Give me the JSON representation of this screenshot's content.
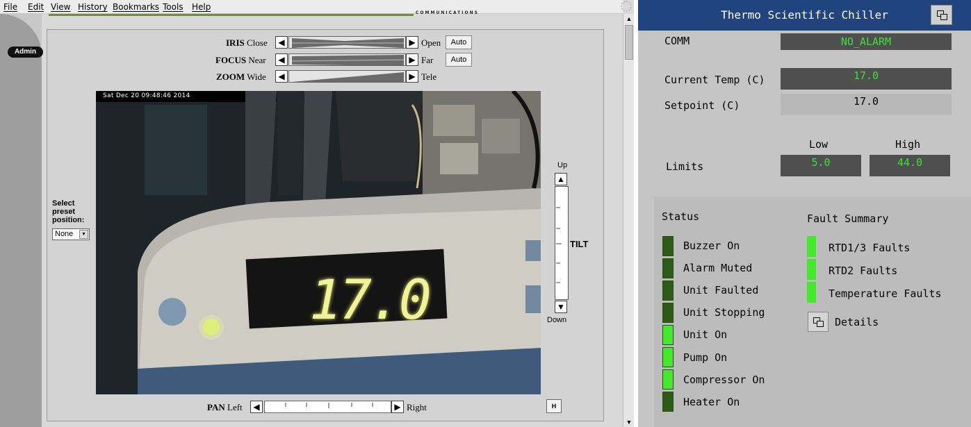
{
  "browser": {
    "menu": [
      "File",
      "Edit",
      "View",
      "History",
      "Bookmarks",
      "Tools",
      "Help"
    ],
    "banner_text": "COMMUNICATIONS",
    "admin_label": "Admin",
    "controls": {
      "iris": {
        "name": "IRIS",
        "left": "Close",
        "right": "Open",
        "auto": "Auto"
      },
      "focus": {
        "name": "FOCUS",
        "left": "Near",
        "right": "Far",
        "auto": "Auto"
      },
      "zoom": {
        "name": "ZOOM",
        "left": "Wide",
        "right": "Tele"
      },
      "pan": {
        "name": "PAN",
        "left": "Left",
        "right": "Right"
      },
      "tilt": {
        "name": "TILT",
        "up": "Up",
        "down": "Down"
      },
      "home_button": "H"
    },
    "camera": {
      "timestamp": "Sat Dec 20  09:48:46  2014",
      "display_reading": "17.0"
    },
    "preset": {
      "label": "Select preset position:",
      "value": "None"
    }
  },
  "chiller": {
    "title": "Thermo Scientific Chiller",
    "comm_label": "COMM",
    "comm_value": "NO_ALARM",
    "current_temp_label": "Current Temp (C)",
    "current_temp_value": "17.0",
    "setpoint_label": "Setpoint (C)",
    "setpoint_value": "17.0",
    "limits_label": "Limits",
    "low_label": "Low",
    "high_label": "High",
    "low_value": "5.0",
    "high_value": "44.0",
    "status_title": "Status",
    "status_items": [
      {
        "label": "Buzzer On",
        "on": false
      },
      {
        "label": "Alarm Muted",
        "on": false
      },
      {
        "label": "Unit Faulted",
        "on": false
      },
      {
        "label": "Unit Stopping",
        "on": false
      },
      {
        "label": "Unit On",
        "on": true
      },
      {
        "label": "Pump On",
        "on": true
      },
      {
        "label": "Compressor On",
        "on": true
      },
      {
        "label": "Heater On",
        "on": false
      }
    ],
    "fault_title": "Fault Summary",
    "fault_items": [
      "RTD1/3 Faults",
      "RTD2 Faults",
      "Temperature Faults"
    ],
    "details_label": "Details",
    "colors": {
      "title_bar": "#21447f",
      "led_on": "#46e82d",
      "led_off": "#2e5a17",
      "value_text": "#3ee03a"
    }
  }
}
